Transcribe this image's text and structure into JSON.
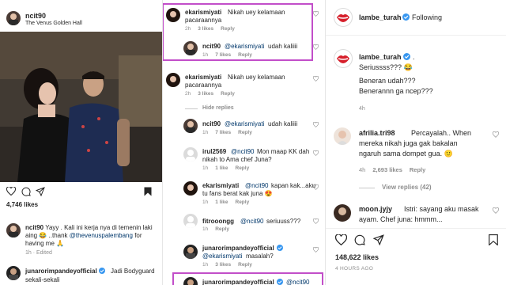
{
  "left": {
    "username": "ncit90",
    "location": "The Venus Golden Hall",
    "likes": "4,746 likes",
    "caption_user": "ncit90",
    "caption_text": "Yayy . Kali ini kerja nya di temenin laki aing 😂 ..thank",
    "caption_mention": "@thevenuspalembang",
    "caption_text2": "for having me 🙏",
    "caption_meta": "1h · Edited",
    "comment_user": "junarorimpandeyofficial",
    "comment_text": "Jadi Bodyguard",
    "comment_text2": "sekali-sekali"
  },
  "middle": {
    "c1": {
      "user": "ekarismiyati",
      "text": "Nikah uey kelamaan",
      "text2": "pacaraannya",
      "time": "2h",
      "likes": "3 likes",
      "reply": "Reply"
    },
    "c2": {
      "user": "ncit90",
      "mention": "@ekarismiyati",
      "text": "udah kaliiii",
      "time": "1h",
      "likes": "7 likes",
      "reply": "Reply"
    },
    "c3": {
      "user": "ekarismiyati",
      "text": "Nikah uey kelamaan",
      "text2": "pacaraannya",
      "time": "2h",
      "likes": "3 likes",
      "reply": "Reply"
    },
    "hide_replies": "Hide replies",
    "c4": {
      "user": "ncit90",
      "mention": "@ekarismiyati",
      "text": "udah kaliiii",
      "time": "1h",
      "likes": "7 likes",
      "reply": "Reply"
    },
    "c5": {
      "user": "irul2569",
      "mention": "@ncit90",
      "text": "Mon maap KK dah",
      "text2": "nikah to Ama chef Juna?",
      "time": "1h",
      "likes": "1 like",
      "reply": "Reply"
    },
    "c6": {
      "user": "ekarismiyati",
      "mention": "@ncit90",
      "text": "kapan kak...aku",
      "text2": "tu fans berat kak juna 😍",
      "time": "1h",
      "likes": "1 like",
      "reply": "Reply"
    },
    "c7": {
      "user": "fitrooongg",
      "mention": "@ncit90",
      "text": "seriuuss???",
      "time": "1h",
      "likes": "",
      "reply": "Reply"
    },
    "c8": {
      "user": "junarorimpandeyofficial",
      "mention": "@ekarismiyati",
      "text2": "masalah?",
      "time": "1h",
      "likes": "3 likes",
      "reply": "Reply"
    },
    "c9": {
      "user": "junarorimpandeyofficial",
      "mention": "@ncit90"
    }
  },
  "right": {
    "account": "lambe_turah",
    "follow": "Following",
    "caption_user": "lambe_turah",
    "caption_lines": [
      ". ",
      "Seriussss??? 😂",
      "Beneran udah???",
      "Benerannn ga ncep???"
    ],
    "caption_time": "4h",
    "c1": {
      "user": "afrilia.tri98",
      "text": "Percayalah.. When",
      "text2": "mereka nikah juga gak bakalan",
      "text3": "ngaruh sama dompet gua. 🙂",
      "time": "4h",
      "likes": "2,693 likes",
      "reply": "Reply"
    },
    "view_replies": "View replies (42)",
    "c2": {
      "user": "moon.jyjy",
      "text": "Istri: sayang aku masak",
      "text2": "ayam. Chef juna: hmmm..."
    },
    "likes": "148,622 likes",
    "time": "4 HOURS AGO"
  },
  "colors": {
    "highlight": "#c24ec9",
    "link": "#00376b",
    "verified": "#3897f0",
    "muted": "#8e8e8e",
    "lambe_red": "#d61f2b"
  }
}
